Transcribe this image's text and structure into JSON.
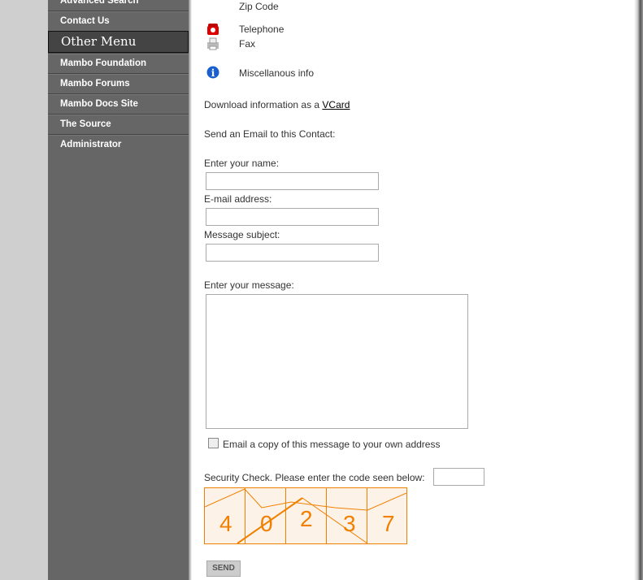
{
  "sidebar": {
    "items_top": [
      "Advanced Search",
      "Contact Us"
    ],
    "heading": "Other Menu",
    "items": [
      "Mambo Foundation",
      "Mambo Forums",
      "Mambo Docs Site",
      "The Source",
      "Administrator"
    ]
  },
  "contact": {
    "zip": "Zip Code",
    "telephone": "Telephone",
    "fax": "Fax",
    "misc": "Miscellanous info",
    "download_prefix": "Download information as a ",
    "vcard": "VCard"
  },
  "form": {
    "intro": "Send an Email to this Contact:",
    "name_label": "Enter your name:",
    "email_label": "E-mail address:",
    "subject_label": "Message subject:",
    "message_label": "Enter your message:",
    "copy_label": "Email a copy of this message to your own address",
    "security_label": "Security Check. Please enter the code seen below:",
    "captcha": [
      "4",
      "0",
      "2",
      "3",
      "7"
    ],
    "send": "SEND"
  },
  "colors": {
    "captcha": "#f08000"
  }
}
